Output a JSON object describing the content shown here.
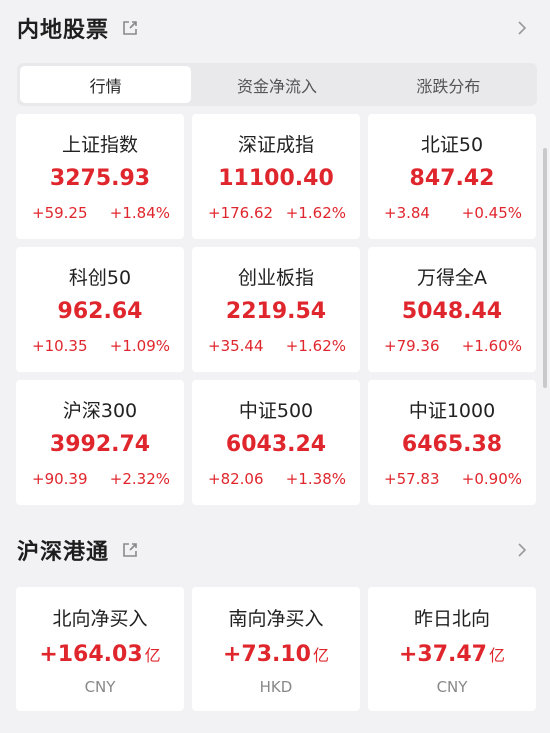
{
  "section1": {
    "title": "内地股票"
  },
  "tabs": [
    {
      "label": "行情",
      "active": true
    },
    {
      "label": "资金净流入",
      "active": false
    },
    {
      "label": "涨跌分布",
      "active": false
    }
  ],
  "indices": [
    {
      "name": "上证指数",
      "value": "3275.93",
      "change": "+59.25",
      "pct": "+1.84%"
    },
    {
      "name": "深证成指",
      "value": "11100.40",
      "change": "+176.62",
      "pct": "+1.62%"
    },
    {
      "name": "北证50",
      "value": "847.42",
      "change": "+3.84",
      "pct": "+0.45%"
    },
    {
      "name": "科创50",
      "value": "962.64",
      "change": "+10.35",
      "pct": "+1.09%"
    },
    {
      "name": "创业板指",
      "value": "2219.54",
      "change": "+35.44",
      "pct": "+1.62%"
    },
    {
      "name": "万得全A",
      "value": "5048.44",
      "change": "+79.36",
      "pct": "+1.60%"
    },
    {
      "name": "沪深300",
      "value": "3992.74",
      "change": "+90.39",
      "pct": "+2.32%"
    },
    {
      "name": "中证500",
      "value": "6043.24",
      "change": "+82.06",
      "pct": "+1.38%"
    },
    {
      "name": "中证1000",
      "value": "6465.38",
      "change": "+57.83",
      "pct": "+0.90%"
    }
  ],
  "section2": {
    "title": "沪深港通"
  },
  "flows": [
    {
      "name": "北向净买入",
      "value": "+164.03",
      "unit": "亿",
      "currency": "CNY"
    },
    {
      "name": "南向净买入",
      "value": "+73.10",
      "unit": "亿",
      "currency": "HKD"
    },
    {
      "name": "昨日北向",
      "value": "+37.47",
      "unit": "亿",
      "currency": "CNY"
    }
  ],
  "colors": {
    "up": "#e0262d",
    "background": "#f2f2f4"
  },
  "icons": {
    "external": "external-link-icon",
    "more": "chevron-right-icon"
  }
}
